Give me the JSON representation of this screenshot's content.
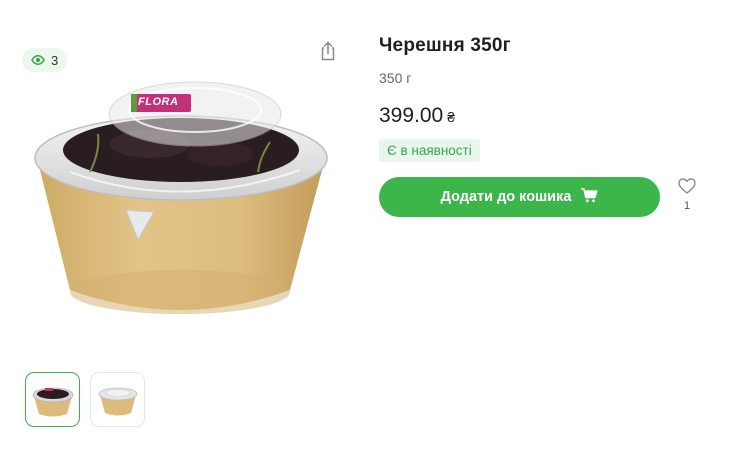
{
  "gallery": {
    "views_count": "3",
    "logo_text": "FLORA",
    "thumbnail_count": 2
  },
  "product": {
    "title": "Черешня 350г",
    "weight": "350 г",
    "price": "399.00",
    "currency": "₴",
    "stock_status": "Є в наявності",
    "add_to_cart_label": "Додати до кошика",
    "favorites_count": "1"
  },
  "colors": {
    "accent": "#3cb54b",
    "stock_bg": "#eaf6ec",
    "stock_text": "#2fa84a"
  },
  "icons": {
    "views": "eye-icon",
    "share": "share-icon",
    "cart": "cart-icon",
    "favorite": "heart-icon"
  }
}
